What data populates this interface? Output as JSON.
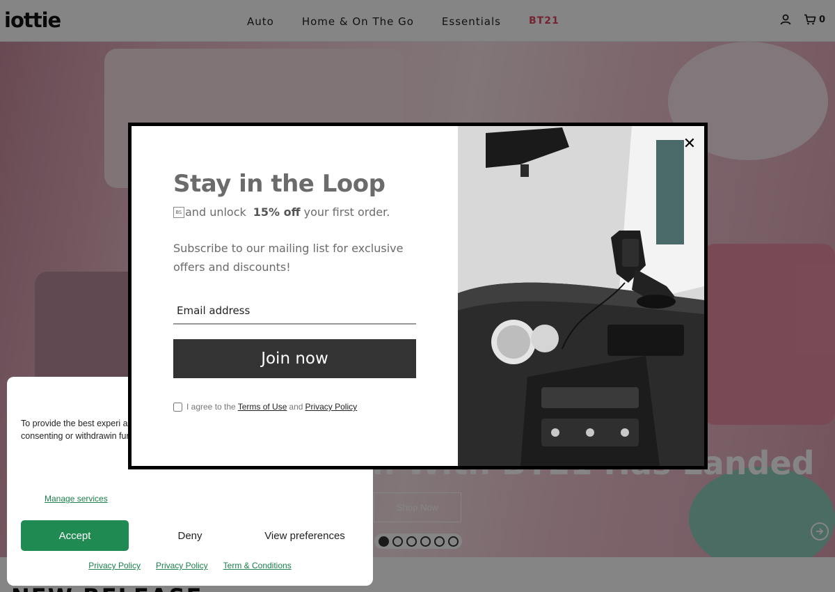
{
  "header": {
    "logo": "iottie",
    "nav": [
      "Auto",
      "Home & On The Go",
      "Essentials",
      "BT21"
    ],
    "cart_count": "0",
    "icons": [
      "user-icon",
      "cart-icon"
    ]
  },
  "hero": {
    "headline": "n With BT21 Has Landed",
    "cta": "Shop Now",
    "slide_count": 6,
    "active_slide": 1
  },
  "section": {
    "heading": "NEW RELEASE"
  },
  "cookie": {
    "text": "To provide the best experi access device information process data such as brov consenting or withdrawin functions.",
    "manage": "Manage services",
    "accept": "Accept",
    "deny": "Deny",
    "preferences": "View preferences",
    "links": [
      "Privacy Policy",
      "Privacy Policy",
      "Term & Conditions"
    ]
  },
  "modal": {
    "title": "Stay in the Loop",
    "sub_glyph": "BS",
    "sub_pre": "and unlock",
    "sub_bold": "15% off",
    "sub_post": "your first order.",
    "description": "Subscribe to our mailing list for exclusive offers and discounts!",
    "email_placeholder": "Email address",
    "button": "Join now",
    "agree_pre": "I agree to the",
    "terms_link": "Terms of Use",
    "agree_and": "and",
    "privacy_link": "Privacy Policy",
    "close": "✕"
  },
  "colors": {
    "accent_green": "#1f8a52",
    "bt21_pink": "#e0465f",
    "button_dark": "#333333"
  }
}
